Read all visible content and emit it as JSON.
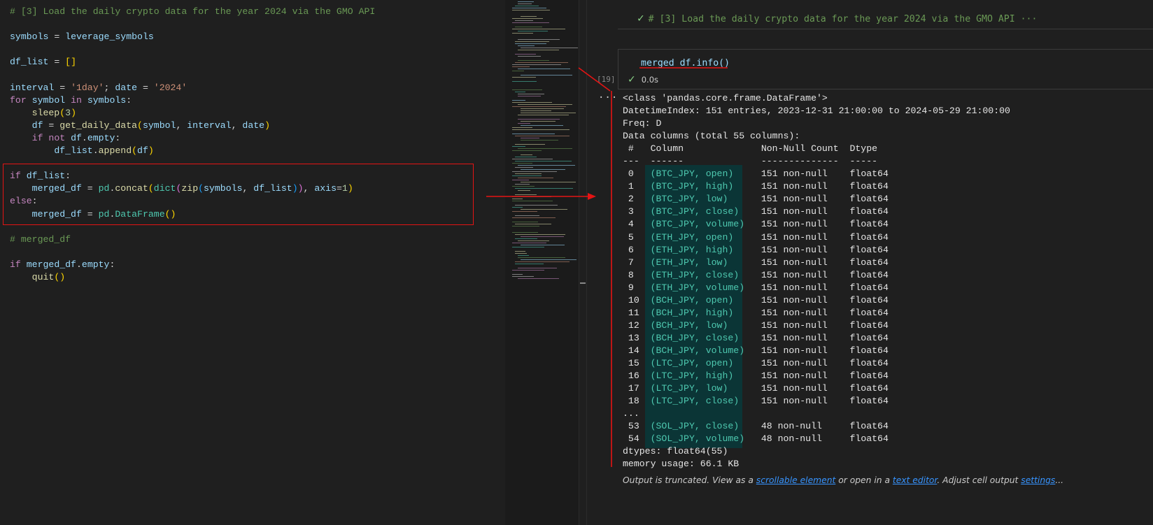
{
  "editor": {
    "lines": [
      [
        [
          "cm",
          "# [3] Load the daily crypto data for the year 2024 via the GMO API"
        ]
      ],
      [],
      [
        [
          "vr",
          "symbols"
        ],
        [
          "op",
          " = "
        ],
        [
          "vr",
          "leverage_symbols"
        ]
      ],
      [],
      [
        [
          "vr",
          "df_list"
        ],
        [
          "op",
          " = "
        ],
        [
          "br1",
          "[]"
        ]
      ],
      [],
      [
        [
          "vr",
          "interval"
        ],
        [
          "op",
          " = "
        ],
        [
          "st",
          "'1day'"
        ],
        [
          "op",
          "; "
        ],
        [
          "vr",
          "date"
        ],
        [
          "op",
          " = "
        ],
        [
          "st",
          "'2024'"
        ]
      ],
      [
        [
          "kw",
          "for"
        ],
        [
          "op",
          " "
        ],
        [
          "vr",
          "symbol"
        ],
        [
          "op",
          " "
        ],
        [
          "kw",
          "in"
        ],
        [
          "op",
          " "
        ],
        [
          "vr",
          "symbols"
        ],
        [
          "op",
          ":"
        ]
      ],
      [
        [
          "op",
          "    "
        ],
        [
          "fn",
          "sleep"
        ],
        [
          "br1",
          "("
        ],
        [
          "nm",
          "3"
        ],
        [
          "br1",
          ")"
        ]
      ],
      [
        [
          "op",
          "    "
        ],
        [
          "vr",
          "df"
        ],
        [
          "op",
          " = "
        ],
        [
          "fn",
          "get_daily_data"
        ],
        [
          "br1",
          "("
        ],
        [
          "vr",
          "symbol"
        ],
        [
          "op",
          ", "
        ],
        [
          "vr",
          "interval"
        ],
        [
          "op",
          ", "
        ],
        [
          "vr",
          "date"
        ],
        [
          "br1",
          ")"
        ]
      ],
      [
        [
          "op",
          "    "
        ],
        [
          "kw",
          "if"
        ],
        [
          "op",
          " "
        ],
        [
          "kw",
          "not"
        ],
        [
          "op",
          " "
        ],
        [
          "vr",
          "df"
        ],
        [
          "op",
          "."
        ],
        [
          "vr",
          "empty"
        ],
        [
          "op",
          ":"
        ]
      ],
      [
        [
          "op",
          "        "
        ],
        [
          "vr",
          "df_list"
        ],
        [
          "op",
          "."
        ],
        [
          "fn",
          "append"
        ],
        [
          "br1",
          "("
        ],
        [
          "vr",
          "df"
        ],
        [
          "br1",
          ")"
        ]
      ],
      [],
      [
        [
          "kw",
          "if"
        ],
        [
          "op",
          " "
        ],
        [
          "vr",
          "df_list"
        ],
        [
          "op",
          ":"
        ]
      ],
      [
        [
          "op",
          "    "
        ],
        [
          "vr",
          "merged_df"
        ],
        [
          "op",
          " = "
        ],
        [
          "cl",
          "pd"
        ],
        [
          "op",
          "."
        ],
        [
          "fn",
          "concat"
        ],
        [
          "br1",
          "("
        ],
        [
          "cl",
          "dict"
        ],
        [
          "br2",
          "("
        ],
        [
          "fn",
          "zip"
        ],
        [
          "br3",
          "("
        ],
        [
          "vr",
          "symbols"
        ],
        [
          "op",
          ", "
        ],
        [
          "vr",
          "df_list"
        ],
        [
          "br3",
          ")"
        ],
        [
          "br2",
          ")"
        ],
        [
          "op",
          ", "
        ],
        [
          "vr",
          "axis"
        ],
        [
          "op",
          "="
        ],
        [
          "nm",
          "1"
        ],
        [
          "br1",
          ")"
        ]
      ],
      [
        [
          "kw",
          "else"
        ],
        [
          "op",
          ":"
        ]
      ],
      [
        [
          "op",
          "    "
        ],
        [
          "vr",
          "merged_df"
        ],
        [
          "op",
          " = "
        ],
        [
          "cl",
          "pd"
        ],
        [
          "op",
          "."
        ],
        [
          "cl",
          "DataFrame"
        ],
        [
          "br1",
          "()"
        ]
      ],
      [],
      [
        [
          "cm",
          "# merged_df"
        ]
      ],
      [],
      [
        [
          "kw",
          "if"
        ],
        [
          "op",
          " "
        ],
        [
          "vr",
          "merged_df"
        ],
        [
          "op",
          "."
        ],
        [
          "vr",
          "empty"
        ],
        [
          "op",
          ":"
        ]
      ],
      [
        [
          "op",
          "    "
        ],
        [
          "fn",
          "quit"
        ],
        [
          "br1",
          "()"
        ]
      ]
    ]
  },
  "notebook": {
    "collapsed_cell_header": "# [3] Load the daily crypto data for the year 2024 via the GMO API ···",
    "cell_code": "merged_df.info()",
    "execution_count": "[19]",
    "execution_time": "0.0s",
    "output_lines": [
      "<class 'pandas.core.frame.DataFrame'>",
      "DatetimeIndex: 151 entries, 2023-12-31 21:00:00 to 2024-05-29 21:00:00",
      "Freq: D",
      "Data columns (total 55 columns):",
      " #   Column              Non-Null Count  Dtype  ",
      "---  ------              --------------  -----  ",
      " 0   (BTC_JPY, open)     151 non-null    float64",
      " 1   (BTC_JPY, high)     151 non-null    float64",
      " 2   (BTC_JPY, low)      151 non-null    float64",
      " 3   (BTC_JPY, close)    151 non-null    float64",
      " 4   (BTC_JPY, volume)   151 non-null    float64",
      " 5   (ETH_JPY, open)     151 non-null    float64",
      " 6   (ETH_JPY, high)     151 non-null    float64",
      " 7   (ETH_JPY, low)      151 non-null    float64",
      " 8   (ETH_JPY, close)    151 non-null    float64",
      " 9   (ETH_JPY, volume)   151 non-null    float64",
      " 10  (BCH_JPY, open)     151 non-null    float64",
      " 11  (BCH_JPY, high)     151 non-null    float64",
      " 12  (BCH_JPY, low)      151 non-null    float64",
      " 13  (BCH_JPY, close)    151 non-null    float64",
      " 14  (BCH_JPY, volume)   151 non-null    float64",
      " 15  (LTC_JPY, open)     151 non-null    float64",
      " 16  (LTC_JPY, high)     151 non-null    float64",
      " 17  (LTC_JPY, low)      151 non-null    float64",
      " 18  (LTC_JPY, close)    151 non-null    float64",
      "...",
      " 53  (SOL_JPY, close)    48 non-null     float64",
      " 54  (SOL_JPY, volume)   48 non-null     float64",
      "dtypes: float64(55)",
      "memory usage: 66.1 KB"
    ],
    "truncation_note": {
      "prefix": "Output is truncated. View as a ",
      "link1": "scrollable element",
      "middle": " or open in a ",
      "link2": "text editor",
      "middle2": ". Adjust cell output ",
      "link3": "settings",
      "suffix": "..."
    }
  },
  "colors": {
    "annotation_red": "#e51414",
    "column_highlight": "#0b3536",
    "success_green": "#89d185"
  }
}
